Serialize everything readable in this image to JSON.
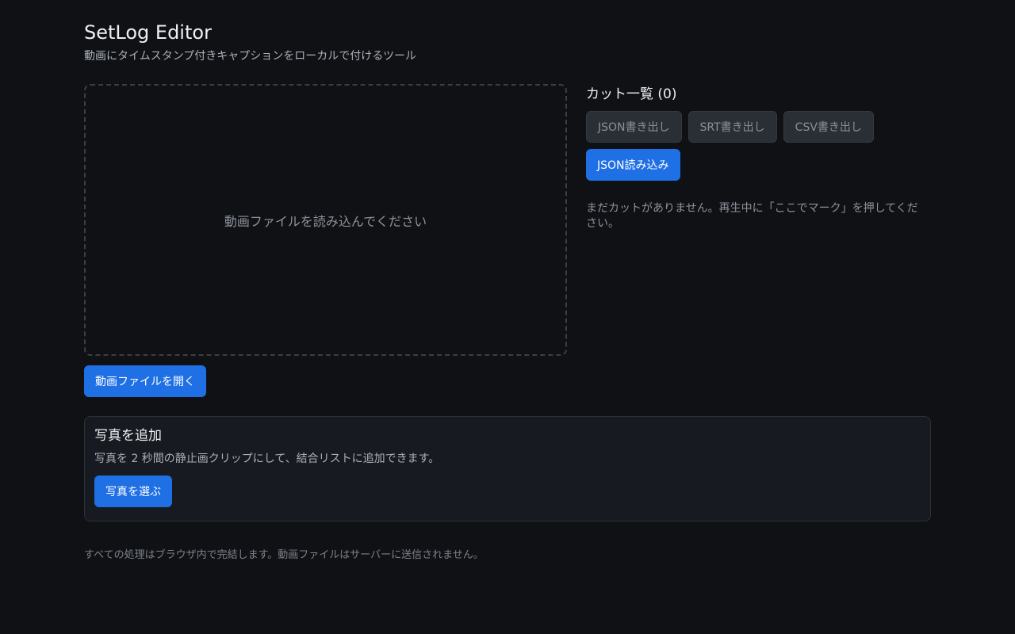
{
  "header": {
    "title": "SetLog Editor",
    "subtitle": "動画にタイムスタンプ付きキャプションをローカルで付けるツール"
  },
  "video": {
    "placeholder": "動画ファイルを読み込んでください",
    "open_button": "動画ファイルを開く"
  },
  "cuts": {
    "heading": "カット一覧 (0)",
    "export_json": "JSON書き出し",
    "export_srt": "SRT書き出し",
    "export_csv": "CSV書き出し",
    "import_json": "JSON読み込み",
    "empty_message": "まだカットがありません。再生中に「ここでマーク」を押してください。"
  },
  "photos": {
    "title": "写真を追加",
    "description": "写真を 2 秒間の静止画クリップにして、結合リストに追加できます。",
    "select_button": "写真を選ぶ"
  },
  "footer": {
    "note": "すべての処理はブラウザ内で完結します。動画ファイルはサーバーに送信されません。"
  },
  "colors": {
    "background": "#0f1115",
    "primary": "#1f6fe5",
    "panel": "#171a20"
  }
}
